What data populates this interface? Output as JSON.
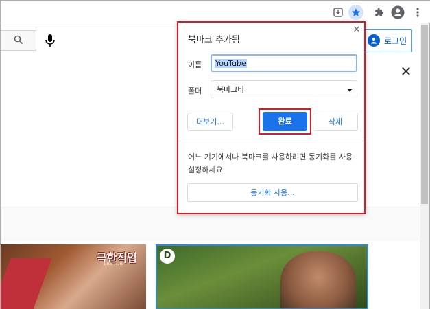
{
  "browser": {
    "icons": [
      "download-icon",
      "star-icon",
      "extensions-icon",
      "profile-icon",
      "menu-icon"
    ]
  },
  "page": {
    "login_label": "로그인",
    "thumb1_title": "극한직업",
    "thumb1_sub": "EBS JOB",
    "thumb2_logo": "D"
  },
  "dialog": {
    "title": "북마크 추가됨",
    "name_label": "이름",
    "name_value": "YouTube",
    "folder_label": "폴더",
    "folder_value": "북마크바",
    "more_label": "더보기...",
    "done_label": "완료",
    "delete_label": "삭제",
    "sync_text": "어느 기기에서나 북마크를 사용하려면 동기화를 사용 설정하세요.",
    "sync_button_label": "동기화 사용...",
    "accent_color": "#1a73e8",
    "highlight_color": "#d51c28"
  }
}
